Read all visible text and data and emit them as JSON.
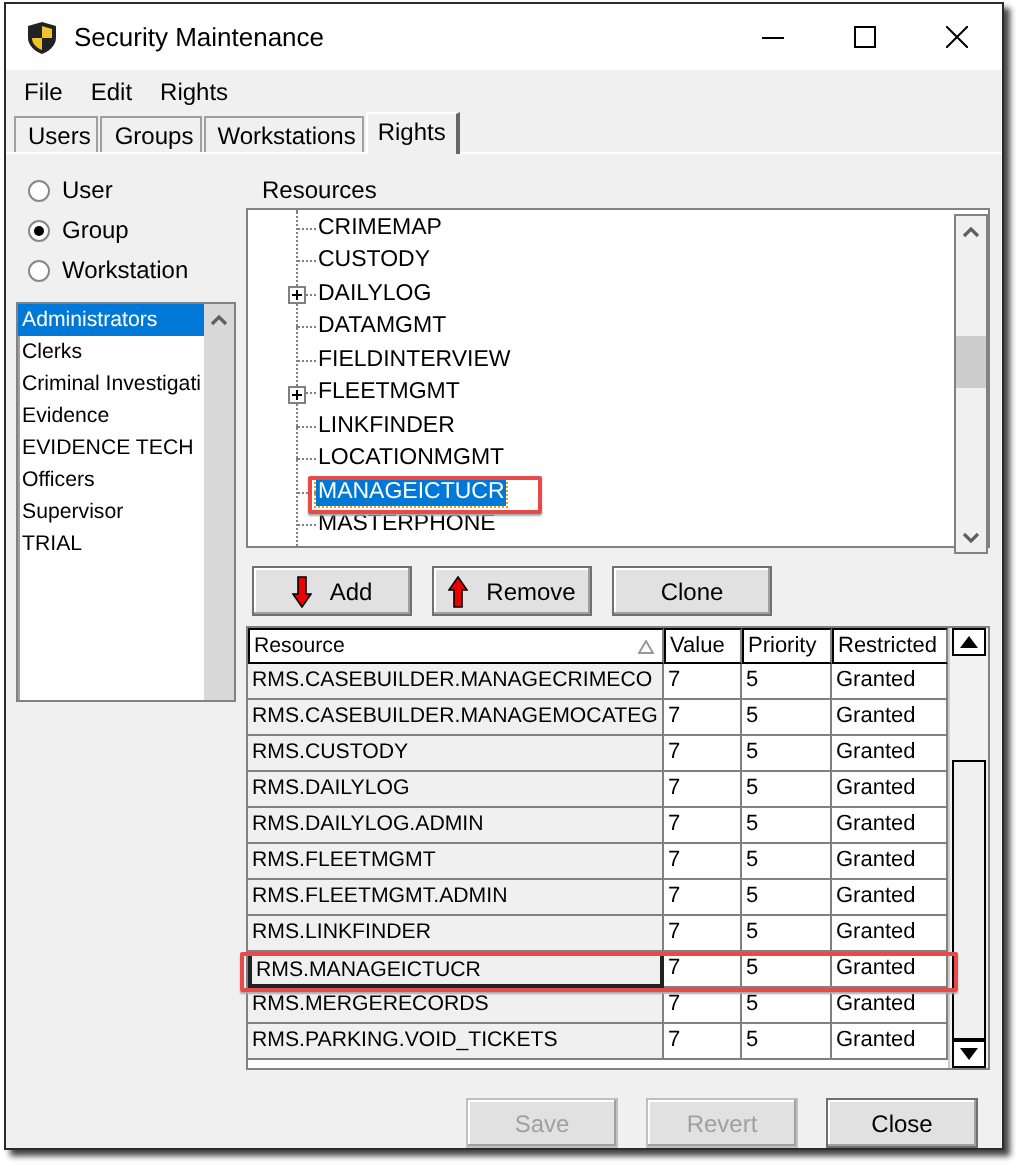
{
  "window": {
    "title": "Security Maintenance"
  },
  "menu": [
    "File",
    "Edit",
    "Rights"
  ],
  "tabs": [
    {
      "label": "Users",
      "selected": false
    },
    {
      "label": "Groups",
      "selected": false
    },
    {
      "label": "Workstations",
      "selected": false
    },
    {
      "label": "Rights",
      "selected": true
    }
  ],
  "scope": [
    {
      "label": "User",
      "selected": false
    },
    {
      "label": "Group",
      "selected": true
    },
    {
      "label": "Workstation",
      "selected": false
    }
  ],
  "groups": [
    {
      "label": "Administrators",
      "selected": true
    },
    {
      "label": "Clerks",
      "selected": false
    },
    {
      "label": "Criminal Investigati",
      "selected": false
    },
    {
      "label": "Evidence",
      "selected": false
    },
    {
      "label": "EVIDENCE TECH",
      "selected": false
    },
    {
      "label": "Officers",
      "selected": false
    },
    {
      "label": "Supervisor",
      "selected": false
    },
    {
      "label": "TRIAL",
      "selected": false
    }
  ],
  "resources": {
    "label": "Resources",
    "items": [
      {
        "label": "CRIMEMAP",
        "expandable": false,
        "selected": false,
        "highlighted": false
      },
      {
        "label": "CUSTODY",
        "expandable": false,
        "selected": false,
        "highlighted": false
      },
      {
        "label": "DAILYLOG",
        "expandable": true,
        "selected": false,
        "highlighted": false
      },
      {
        "label": "DATAMGMT",
        "expandable": false,
        "selected": false,
        "highlighted": false
      },
      {
        "label": "FIELDINTERVIEW",
        "expandable": false,
        "selected": false,
        "highlighted": false
      },
      {
        "label": "FLEETMGMT",
        "expandable": true,
        "selected": false,
        "highlighted": false
      },
      {
        "label": "LINKFINDER",
        "expandable": false,
        "selected": false,
        "highlighted": false
      },
      {
        "label": "LOCATIONMGMT",
        "expandable": false,
        "selected": false,
        "highlighted": false
      },
      {
        "label": "MANAGEICTUCR",
        "expandable": false,
        "selected": true,
        "highlighted": true
      },
      {
        "label": "MASTERPHONE",
        "expandable": false,
        "selected": false,
        "highlighted": false
      }
    ]
  },
  "actions": [
    {
      "label": "Add",
      "kind": "down"
    },
    {
      "label": "Remove",
      "kind": "up"
    },
    {
      "label": "Clone",
      "kind": "plain"
    }
  ],
  "table": {
    "columns": [
      "Resource",
      "Value",
      "Priority",
      "Restricted"
    ],
    "rows": [
      {
        "cells": [
          "RMS.CASEBUILDER.MANAGECRIMECO",
          "7",
          "5",
          "Granted"
        ],
        "highlighted": false
      },
      {
        "cells": [
          "RMS.CASEBUILDER.MANAGEMOCATEG",
          "7",
          "5",
          "Granted"
        ],
        "highlighted": false
      },
      {
        "cells": [
          "RMS.CUSTODY",
          "7",
          "5",
          "Granted"
        ],
        "highlighted": false
      },
      {
        "cells": [
          "RMS.DAILYLOG",
          "7",
          "5",
          "Granted"
        ],
        "highlighted": false
      },
      {
        "cells": [
          "RMS.DAILYLOG.ADMIN",
          "7",
          "5",
          "Granted"
        ],
        "highlighted": false
      },
      {
        "cells": [
          "RMS.FLEETMGMT",
          "7",
          "5",
          "Granted"
        ],
        "highlighted": false
      },
      {
        "cells": [
          "RMS.FLEETMGMT.ADMIN",
          "7",
          "5",
          "Granted"
        ],
        "highlighted": false
      },
      {
        "cells": [
          "RMS.LINKFINDER",
          "7",
          "5",
          "Granted"
        ],
        "highlighted": false
      },
      {
        "cells": [
          "RMS.MANAGEICTUCR",
          "7",
          "5",
          "Granted"
        ],
        "highlighted": true
      },
      {
        "cells": [
          "RMS.MERGERECORDS",
          "7",
          "5",
          "Granted"
        ],
        "highlighted": false
      },
      {
        "cells": [
          "RMS.PARKING.VOID_TICKETS",
          "7",
          "5",
          "Granted"
        ],
        "highlighted": false
      }
    ]
  },
  "buttons": [
    {
      "label": "Save",
      "disabled": true
    },
    {
      "label": "Revert",
      "disabled": true
    },
    {
      "label": "Close",
      "disabled": false
    }
  ]
}
